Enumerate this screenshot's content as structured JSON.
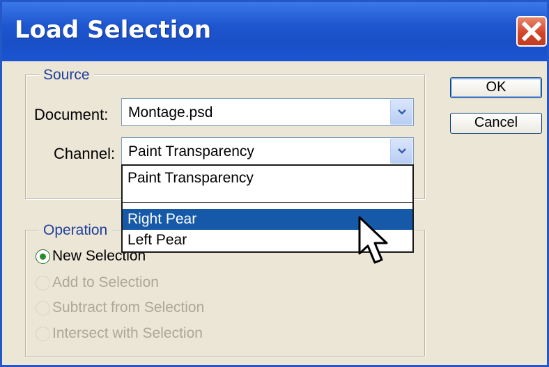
{
  "dialog": {
    "title": "Load Selection"
  },
  "source": {
    "legend": "Source",
    "document_label": "Document:",
    "document_value": "Montage.psd",
    "channel_label": "Channel:",
    "channel_value": "Paint Transparency",
    "channel_options": [
      "Paint Transparency",
      "Right Pear",
      "Left Pear"
    ],
    "highlighted_option": "Right Pear"
  },
  "operation": {
    "legend": "Operation",
    "options": [
      {
        "label": "New Selection",
        "selected": true,
        "enabled": true
      },
      {
        "label": "Add to Selection",
        "selected": false,
        "enabled": false
      },
      {
        "label": "Subtract from Selection",
        "selected": false,
        "enabled": false
      },
      {
        "label": "Intersect with Selection",
        "selected": false,
        "enabled": false
      }
    ]
  },
  "buttons": {
    "ok": "OK",
    "cancel": "Cancel"
  },
  "colors": {
    "titlebar": "#1b55d3",
    "close": "#d4452a",
    "highlight": "#1559a8",
    "radio_selected": "#2b8a2b"
  },
  "icons": {
    "close": "close-icon",
    "combo_arrow": "chevron-down-icon",
    "cursor": "mouse-pointer-icon"
  }
}
